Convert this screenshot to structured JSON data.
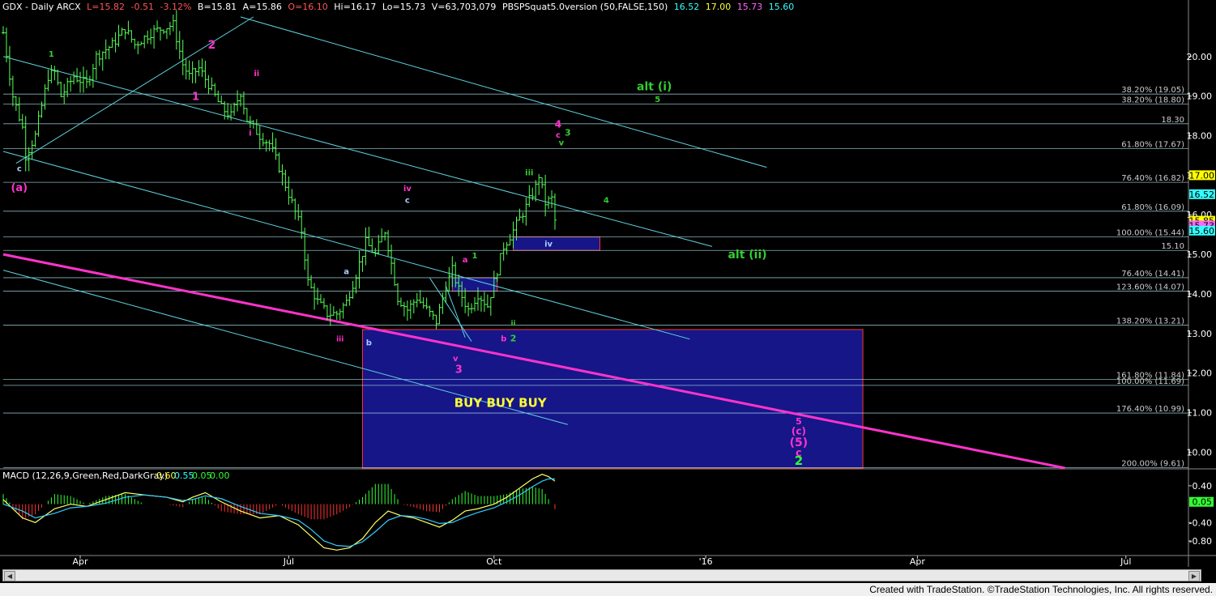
{
  "header": {
    "symbol": "GDX - Daily  ARCX",
    "last": "L=15.82",
    "change": "-0.51",
    "pct": "-3.12%",
    "bid": "B=15.81",
    "ask": "A=15.86",
    "open": "O=16.10",
    "high": "Hi=16.17",
    "low": "Lo=15.73",
    "volume": "V=63,703,079",
    "study": "PBSPSquat5.0version (50,FALSE,150)",
    "v1": "16.52",
    "v2": "17.00",
    "v3": "15.73",
    "v4": "15.60"
  },
  "colors": {
    "background": "#000000",
    "bar": "#55ff55",
    "channel": "#5fd3e0",
    "trend": "#ff33cc",
    "box_fill": "#1a1aa0",
    "box_border": "#ff3333",
    "green_label": "#33cc33",
    "magenta_label": "#ff33cc",
    "yellow_label": "#ffff33",
    "fib_text": "#cccccc"
  },
  "footer": {
    "credit": "Created with TradeStation. ©TradeStation Technologies, Inc. All rights reserved."
  },
  "chart_data": [
    {
      "type": "ohlc",
      "ylim": [
        9.6,
        21.1
      ],
      "y_ticks": [
        "20.00",
        "19.00",
        "18.00",
        "17.00",
        "16.00",
        "15.00",
        "14.00",
        "13.00",
        "12.00",
        "11.00",
        "10.00"
      ],
      "y_tick_values": [
        20,
        19,
        18,
        17,
        16,
        15,
        14,
        13,
        12,
        11,
        10
      ],
      "x_labels": [
        "Apr",
        "Jul",
        "Oct",
        "'16",
        "Apr",
        "Jul"
      ],
      "x_label_idx": [
        28,
        93,
        157,
        223,
        289,
        354
      ],
      "x_range": [
        4,
        373
      ],
      "price_markers": [
        {
          "label": "17.00",
          "value": 17.0,
          "bg": "#ffff00"
        },
        {
          "label": "16.52",
          "value": 16.52,
          "bg": "#33ffff"
        },
        {
          "label": "15.85",
          "value": 15.85,
          "bg": "#ffff00"
        },
        {
          "label": "15.73",
          "value": 15.73,
          "bg": "#ff66ff"
        },
        {
          "label": "15.60",
          "value": 15.6,
          "bg": "#33ffff"
        }
      ],
      "fib_levels": [
        {
          "label": "38.20% (19.05)",
          "value": 19.05
        },
        {
          "label": "38.20% (18.80)",
          "value": 18.8
        },
        {
          "label": "18.30",
          "value": 18.3
        },
        {
          "label": "61.80% (17.67)",
          "value": 17.67
        },
        {
          "label": "76.40% (16.82)",
          "value": 16.82
        },
        {
          "label": "61.80% (16.09)",
          "value": 16.09
        },
        {
          "label": "100.00% (15.44)",
          "value": 15.44
        },
        {
          "label": "15.10",
          "value": 15.1
        },
        {
          "label": "76.40% (14.41)",
          "value": 14.41
        },
        {
          "label": "123.60% (14.07)",
          "value": 14.07
        },
        {
          "label": "138.20% (13.21)",
          "value": 13.21
        },
        {
          "label": "161.80% (11.84)",
          "value": 11.84
        },
        {
          "label": "100.00% (11.69)",
          "value": 11.69
        },
        {
          "label": "176.40% (10.99)",
          "value": 10.99
        },
        {
          "label": "200.00% (9.61)",
          "value": 9.61
        }
      ],
      "close_path": [
        [
          4,
          20.6
        ],
        [
          7,
          19.0
        ],
        [
          10,
          18.2
        ],
        [
          11,
          17.5
        ],
        [
          14,
          18.0
        ],
        [
          18,
          19.5
        ],
        [
          20,
          19.6
        ],
        [
          22,
          19.0
        ],
        [
          26,
          19.5
        ],
        [
          30,
          19.3
        ],
        [
          33,
          20.0
        ],
        [
          38,
          20.3
        ],
        [
          42,
          20.7
        ],
        [
          45,
          20.3
        ],
        [
          50,
          20.6
        ],
        [
          53,
          20.7
        ],
        [
          57,
          20.8
        ],
        [
          60,
          19.8
        ],
        [
          62,
          19.5
        ],
        [
          65,
          19.7
        ],
        [
          68,
          19.3
        ],
        [
          72,
          18.7
        ],
        [
          75,
          18.5
        ],
        [
          78,
          19.1
        ],
        [
          80,
          18.4
        ],
        [
          84,
          18.0
        ],
        [
          87,
          17.8
        ],
        [
          90,
          17.2
        ],
        [
          94,
          16.3
        ],
        [
          97,
          15.6
        ],
        [
          99,
          14.3
        ],
        [
          102,
          13.8
        ],
        [
          105,
          13.5
        ],
        [
          108,
          13.5
        ],
        [
          111,
          13.8
        ],
        [
          114,
          14.5
        ],
        [
          117,
          15.3
        ],
        [
          120,
          15.0
        ],
        [
          123,
          15.6
        ],
        [
          124,
          15.2
        ],
        [
          127,
          13.9
        ],
        [
          130,
          13.6
        ],
        [
          133,
          13.9
        ],
        [
          136,
          13.6
        ],
        [
          139,
          13.3
        ],
        [
          142,
          14.2
        ],
        [
          144,
          14.6
        ],
        [
          146,
          14.1
        ],
        [
          149,
          13.6
        ],
        [
          152,
          14.0
        ],
        [
          155,
          13.7
        ],
        [
          157,
          14.3
        ],
        [
          160,
          15.2
        ],
        [
          163,
          15.6
        ],
        [
          167,
          16.2
        ],
        [
          170,
          16.7
        ],
        [
          171,
          17.0
        ],
        [
          173,
          16.3
        ],
        [
          175,
          16.4
        ],
        [
          176,
          15.85
        ]
      ],
      "trend_lines": [
        {
          "kind": "channel",
          "p1": [
            4,
            20.0
          ],
          "p2": [
            225,
            15.2
          ]
        },
        {
          "kind": "channel",
          "p1": [
            4,
            17.6
          ],
          "p2": [
            218,
            12.86
          ]
        },
        {
          "kind": "channel",
          "p1": [
            4,
            14.6
          ],
          "p2": [
            180,
            10.7
          ]
        },
        {
          "kind": "channel",
          "p1": [
            78,
            21.0
          ],
          "p2": [
            242,
            17.2
          ]
        },
        {
          "kind": "channel",
          "p1": [
            8,
            17.3
          ],
          "p2": [
            82,
            21.0
          ]
        },
        {
          "kind": "channel",
          "p1": [
            137,
            14.4
          ],
          "p2": [
            150,
            12.8
          ]
        },
        {
          "kind": "channel",
          "p1": [
            142,
            14.2
          ],
          "p2": [
            148,
            12.9
          ]
        },
        {
          "kind": "trend",
          "p1": [
            4,
            15.0
          ],
          "p2": [
            335,
            9.6
          ]
        }
      ],
      "boxes": [
        {
          "x1": 116,
          "x2": 272,
          "y1": 13.1,
          "y2": 9.6,
          "border": "#ff3333"
        },
        {
          "x1": 144,
          "x2": 158,
          "y1": 14.41,
          "y2": 14.07,
          "border": "#ff3333"
        },
        {
          "x1": 163,
          "x2": 190,
          "y1": 15.44,
          "y2": 15.1,
          "border": "#ff3333"
        }
      ],
      "annotations": [
        {
          "text": "c",
          "x": 9,
          "y": 17.1,
          "color": "#aaccff",
          "size": 10
        },
        {
          "text": "(a)",
          "x": 9,
          "y": 16.6,
          "color": "#ff33cc",
          "size": 13
        },
        {
          "text": "1",
          "x": 19,
          "y": 20.0,
          "color": "#33cc33",
          "size": 10
        },
        {
          "text": "2",
          "x": 69,
          "y": 20.2,
          "color": "#ff33cc",
          "size": 14
        },
        {
          "text": "1",
          "x": 64,
          "y": 18.9,
          "color": "#ff33cc",
          "size": 13
        },
        {
          "text": "ii",
          "x": 83,
          "y": 19.5,
          "color": "#ff33cc",
          "size": 10
        },
        {
          "text": "i",
          "x": 81,
          "y": 18.0,
          "color": "#ff33cc",
          "size": 10
        },
        {
          "text": "a",
          "x": 111,
          "y": 14.5,
          "color": "#aaccff",
          "size": 10
        },
        {
          "text": "iii",
          "x": 109,
          "y": 12.8,
          "color": "#ff33cc",
          "size": 9
        },
        {
          "text": "b",
          "x": 118,
          "y": 12.7,
          "color": "#aaccff",
          "size": 10
        },
        {
          "text": "iv",
          "x": 130,
          "y": 16.6,
          "color": "#ff33cc",
          "size": 10
        },
        {
          "text": "c",
          "x": 130,
          "y": 16.3,
          "color": "#aaccff",
          "size": 10
        },
        {
          "text": "v",
          "x": 145,
          "y": 12.3,
          "color": "#ff33cc",
          "size": 10
        },
        {
          "text": "3",
          "x": 146,
          "y": 12.0,
          "color": "#ff33cc",
          "size": 13
        },
        {
          "text": "a",
          "x": 148,
          "y": 14.8,
          "color": "#ff33cc",
          "size": 10
        },
        {
          "text": "1",
          "x": 151,
          "y": 14.9,
          "color": "#33cc33",
          "size": 10
        },
        {
          "text": "b",
          "x": 160,
          "y": 12.8,
          "color": "#ff33cc",
          "size": 10
        },
        {
          "text": "2",
          "x": 163,
          "y": 12.8,
          "color": "#33cc33",
          "size": 11
        },
        {
          "text": "ii",
          "x": 163,
          "y": 13.2,
          "color": "#33cc33",
          "size": 9
        },
        {
          "text": "iii",
          "x": 168,
          "y": 17.0,
          "color": "#33cc33",
          "size": 10
        },
        {
          "text": "iv",
          "x": 174,
          "y": 15.2,
          "color": "#aaccff",
          "size": 10
        },
        {
          "text": "4",
          "x": 192,
          "y": 16.3,
          "color": "#33cc33",
          "size": 10
        },
        {
          "text": "4",
          "x": 177,
          "y": 18.2,
          "color": "#ff33cc",
          "size": 12
        },
        {
          "text": "c",
          "x": 177,
          "y": 17.95,
          "color": "#ff33cc",
          "size": 10
        },
        {
          "text": "3",
          "x": 180,
          "y": 18.0,
          "color": "#33cc33",
          "size": 11
        },
        {
          "text": "v",
          "x": 178,
          "y": 17.75,
          "color": "#33cc33",
          "size": 10
        },
        {
          "text": "alt (i)",
          "x": 207,
          "y": 19.15,
          "color": "#33cc33",
          "size": 14
        },
        {
          "text": "5",
          "x": 208,
          "y": 18.85,
          "color": "#33cc33",
          "size": 10
        },
        {
          "text": "alt (ii)",
          "x": 236,
          "y": 14.9,
          "color": "#33cc33",
          "size": 14
        },
        {
          "text": "BUY BUY  BUY",
          "x": 159,
          "y": 11.15,
          "color": "#ffff33",
          "size": 15
        },
        {
          "text": "5",
          "x": 252,
          "y": 10.7,
          "color": "#ff33cc",
          "size": 11
        },
        {
          "text": "(c)",
          "x": 252,
          "y": 10.45,
          "color": "#ff33cc",
          "size": 12
        },
        {
          "text": "(5)",
          "x": 252,
          "y": 10.15,
          "color": "#ff33cc",
          "size": 14
        },
        {
          "text": "c",
          "x": 252,
          "y": 9.9,
          "color": "#ff33cc",
          "size": 13
        },
        {
          "text": "2",
          "x": 252,
          "y": 9.68,
          "color": "#33ff33",
          "size": 15
        }
      ]
    },
    {
      "type": "macd",
      "title": "MACD (12,26,9,Green,Red,DarkGray)",
      "values_text": [
        "0.60",
        "0.55",
        "0.05",
        "0.00"
      ],
      "ylim": [
        -1.1,
        0.75
      ],
      "y_ticks": [
        "0.40",
        "-0.40",
        "-0.80"
      ],
      "y_tick_values": [
        0.4,
        -0.4,
        -0.8
      ],
      "marker": {
        "label": "0.05",
        "value": 0.05,
        "bg": "#33ff33"
      },
      "macd_path": [
        [
          4,
          0.1
        ],
        [
          10,
          -0.3
        ],
        [
          14,
          -0.4
        ],
        [
          20,
          -0.1
        ],
        [
          25,
          0.0
        ],
        [
          30,
          -0.05
        ],
        [
          36,
          0.1
        ],
        [
          42,
          0.25
        ],
        [
          48,
          0.2
        ],
        [
          55,
          0.15
        ],
        [
          60,
          0.05
        ],
        [
          63,
          0.15
        ],
        [
          67,
          0.25
        ],
        [
          72,
          0.05
        ],
        [
          78,
          -0.15
        ],
        [
          84,
          -0.3
        ],
        [
          90,
          -0.25
        ],
        [
          96,
          -0.45
        ],
        [
          100,
          -0.7
        ],
        [
          104,
          -0.95
        ],
        [
          108,
          -1.0
        ],
        [
          112,
          -0.95
        ],
        [
          116,
          -0.75
        ],
        [
          120,
          -0.4
        ],
        [
          124,
          -0.15
        ],
        [
          128,
          -0.25
        ],
        [
          132,
          -0.3
        ],
        [
          136,
          -0.4
        ],
        [
          140,
          -0.5
        ],
        [
          144,
          -0.35
        ],
        [
          148,
          -0.15
        ],
        [
          152,
          -0.1
        ],
        [
          157,
          0.0
        ],
        [
          161,
          0.15
        ],
        [
          165,
          0.35
        ],
        [
          169,
          0.55
        ],
        [
          172,
          0.65
        ],
        [
          174,
          0.6
        ],
        [
          176,
          0.5
        ]
      ],
      "signal_path": [
        [
          4,
          0.0
        ],
        [
          10,
          -0.15
        ],
        [
          14,
          -0.3
        ],
        [
          20,
          -0.2
        ],
        [
          25,
          -0.08
        ],
        [
          30,
          -0.05
        ],
        [
          36,
          0.02
        ],
        [
          42,
          0.15
        ],
        [
          48,
          0.2
        ],
        [
          55,
          0.15
        ],
        [
          60,
          0.08
        ],
        [
          63,
          0.1
        ],
        [
          67,
          0.18
        ],
        [
          72,
          0.12
        ],
        [
          78,
          -0.05
        ],
        [
          84,
          -0.2
        ],
        [
          90,
          -0.25
        ],
        [
          96,
          -0.35
        ],
        [
          100,
          -0.55
        ],
        [
          104,
          -0.8
        ],
        [
          108,
          -0.9
        ],
        [
          112,
          -0.92
        ],
        [
          116,
          -0.82
        ],
        [
          120,
          -0.6
        ],
        [
          124,
          -0.35
        ],
        [
          128,
          -0.25
        ],
        [
          132,
          -0.27
        ],
        [
          136,
          -0.33
        ],
        [
          140,
          -0.42
        ],
        [
          144,
          -0.4
        ],
        [
          148,
          -0.28
        ],
        [
          152,
          -0.18
        ],
        [
          157,
          -0.08
        ],
        [
          161,
          0.05
        ],
        [
          165,
          0.2
        ],
        [
          169,
          0.38
        ],
        [
          172,
          0.5
        ],
        [
          174,
          0.55
        ],
        [
          176,
          0.55
        ]
      ]
    }
  ]
}
